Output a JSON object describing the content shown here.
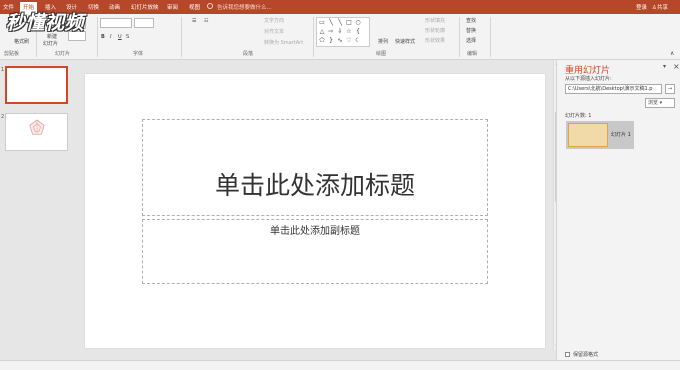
{
  "tabs": [
    {
      "label": "文件"
    },
    {
      "label": "开始"
    },
    {
      "label": "插入"
    },
    {
      "label": "设计"
    },
    {
      "label": "切换"
    },
    {
      "label": "动画"
    },
    {
      "label": "幻灯片放映"
    },
    {
      "label": "审阅"
    },
    {
      "label": "视图"
    }
  ],
  "tellme": "告诉我您想要做什么...",
  "login": "登录",
  "share": "共享",
  "logo_text": "秒懂视频",
  "ribbon": {
    "format_painter": "格式刷",
    "new_slide": "新建",
    "new_slide_line2": "幻灯片",
    "text_direction": "文字方向",
    "align_text": "对齐文本",
    "convert_smartart": "转换为 SmartArt",
    "arrange": "排列",
    "quick_styles": "快速样式",
    "shape_fill": "形状填充",
    "shape_outline": "形状轮廓",
    "shape_effects": "形状效果",
    "find": "查找",
    "replace": "替换",
    "select": "选择",
    "groups": {
      "clipboard": "剪贴板",
      "slides": "幻灯片",
      "font": "字体",
      "paragraph": "段落",
      "drawing": "绘图",
      "editing": "编辑"
    }
  },
  "thumbnails": [
    {
      "number": "1"
    },
    {
      "number": "2"
    }
  ],
  "slide": {
    "title": "单击此处添加标题",
    "subtitle": "单击此处添加副标题"
  },
  "task_pane": {
    "title": "重用幻灯片",
    "insert_label": "从以下源插入幻灯片:",
    "path": "C:\\Users\\北航\\Desktop\\演示文稿1.p",
    "go": "→",
    "browse": "浏览",
    "count_label": "幻灯片数: 1",
    "card_label": "幻灯片 1",
    "keep_format": "保留源格式"
  },
  "colors": {
    "accent": "#b7472a",
    "title_accent": "#d24726"
  }
}
